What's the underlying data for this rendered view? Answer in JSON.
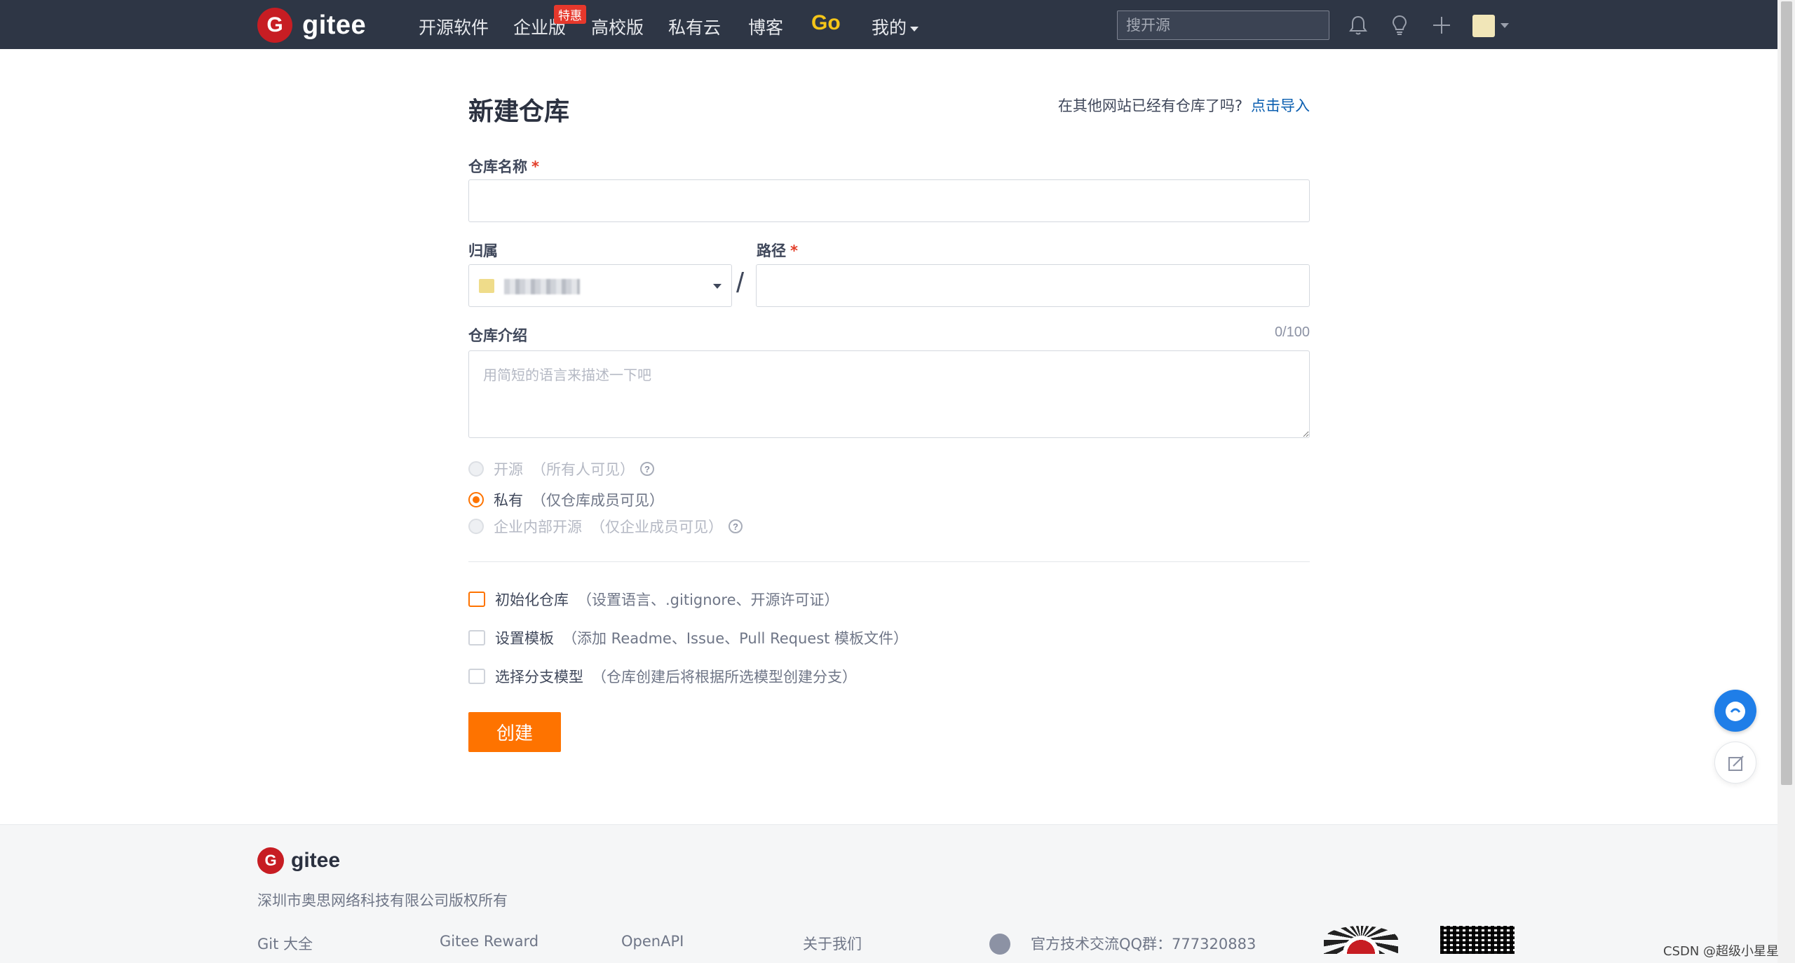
{
  "nav": {
    "logo_text": "gitee",
    "items": [
      "开源软件",
      "企业版",
      "高校版",
      "私有云",
      "博客"
    ],
    "badge": "特惠",
    "go": "Go",
    "mine": "我的",
    "search_placeholder": "搜开源"
  },
  "form": {
    "title": "新建仓库",
    "import_hint": "在其他网站已经有仓库了吗?",
    "import_link": "点击导入",
    "repo_name_label": "仓库名称",
    "required_mark": "*",
    "owner_label": "归属",
    "path_label": "路径",
    "slash": "/",
    "desc_label": "仓库介绍",
    "desc_counter": "0/100",
    "desc_placeholder": "用简短的语言来描述一下吧",
    "visibility": [
      {
        "label": "开源",
        "desc": "（所有人可见）",
        "checked": false,
        "disabled": true,
        "help": true
      },
      {
        "label": "私有",
        "desc": "（仅仓库成员可见）",
        "checked": true,
        "disabled": false,
        "help": false
      },
      {
        "label": "企业内部开源",
        "desc": "（仅企业成员可见）",
        "checked": false,
        "disabled": true,
        "help": true
      }
    ],
    "options": [
      {
        "label": "初始化仓库",
        "desc": "（设置语言、.gitignore、开源许可证）"
      },
      {
        "label": "设置模板",
        "desc": "（添加 Readme、Issue、Pull Request 模板文件）"
      },
      {
        "label": "选择分支模型",
        "desc": "（仓库创建后将根据所选模型创建分支）"
      }
    ],
    "submit": "创建"
  },
  "footer": {
    "logo_text": "gitee",
    "copyright": "深圳市奥思网络科技有限公司版权所有",
    "links": [
      "Git 大全",
      "Gitee Reward",
      "OpenAPI",
      "关于我们"
    ],
    "qq_group": "官方技术交流QQ群：777320883"
  },
  "watermark": "CSDN @超级小星星",
  "colors": {
    "nav_bg": "#2e3645",
    "accent": "#fe7300",
    "brand_red": "#c71d23",
    "link": "#0a5eb0"
  }
}
